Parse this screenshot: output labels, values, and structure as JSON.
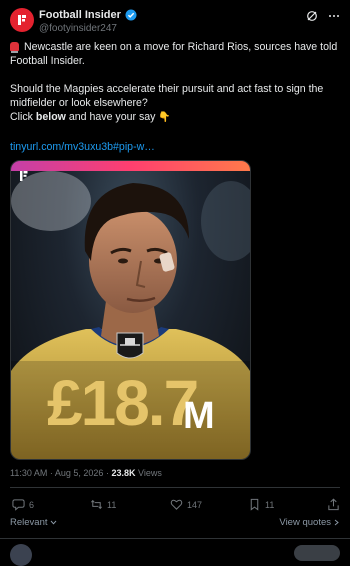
{
  "account": {
    "name": "Football Insider",
    "handle": "@footyinsider247"
  },
  "post": {
    "line1": "Newcastle are keen on a move for Richard Rios, sources have told Football Insider.",
    "line2": "Should the Magpies accelerate their pursuit and act fast to sign the midfielder or look elsewhere?",
    "line3_prefix": "Click ",
    "line3_bold": "below",
    "line3_suffix": " and have your say",
    "link": "tinyurl.com/mv3uxu3b#pip-w…"
  },
  "media": {
    "fee_value": "£18.7",
    "fee_unit": "M",
    "accent_colors": {
      "gold": "#e5c46a",
      "brand_red": "#e4222f"
    }
  },
  "meta": {
    "time": "11:30 AM",
    "date": "Aug 5, 2026",
    "views_count": "23.8K",
    "views_label": "Views"
  },
  "actions": {
    "replies": "6",
    "reposts": "11",
    "likes": "147",
    "bookmarks": "11"
  },
  "footer": {
    "sort_label": "Relevant",
    "view_quotes_label": "View quotes"
  },
  "icons": [
    "verified-badge-icon",
    "grok-icon",
    "more-icon",
    "reply-icon",
    "repost-icon",
    "like-icon",
    "bookmark-icon",
    "share-icon",
    "chevron-down-icon",
    "chevron-right-icon"
  ]
}
